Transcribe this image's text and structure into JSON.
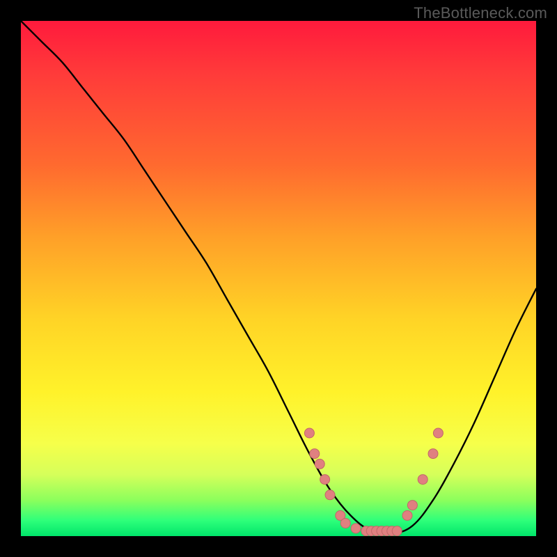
{
  "watermark": "TheBottleneck.com",
  "colors": {
    "curve": "#000000",
    "marker_fill": "#e08080",
    "marker_stroke": "#c06868",
    "gradient_top": "#ff1a3c",
    "gradient_bottom": "#00e56a"
  },
  "chart_data": {
    "type": "line",
    "title": "",
    "xlabel": "",
    "ylabel": "",
    "xlim": [
      0,
      100
    ],
    "ylim": [
      0,
      100
    ],
    "series": [
      {
        "name": "bottleneck-curve",
        "x": [
          0,
          4,
          8,
          12,
          16,
          20,
          24,
          28,
          32,
          36,
          40,
          44,
          48,
          52,
          56,
          60,
          64,
          68,
          72,
          76,
          80,
          84,
          88,
          92,
          96,
          100
        ],
        "y": [
          100,
          96,
          92,
          87,
          82,
          77,
          71,
          65,
          59,
          53,
          46,
          39,
          32,
          24,
          16,
          9,
          4,
          1,
          0.5,
          2,
          7,
          14,
          22,
          31,
          40,
          48
        ]
      }
    ],
    "markers": [
      {
        "x": 56,
        "y": 20
      },
      {
        "x": 57,
        "y": 16
      },
      {
        "x": 58,
        "y": 14
      },
      {
        "x": 59,
        "y": 11
      },
      {
        "x": 60,
        "y": 8
      },
      {
        "x": 62,
        "y": 4
      },
      {
        "x": 63,
        "y": 2.5
      },
      {
        "x": 65,
        "y": 1.5
      },
      {
        "x": 67,
        "y": 1
      },
      {
        "x": 68,
        "y": 1
      },
      {
        "x": 69,
        "y": 1
      },
      {
        "x": 70,
        "y": 1
      },
      {
        "x": 71,
        "y": 1
      },
      {
        "x": 72,
        "y": 1
      },
      {
        "x": 73,
        "y": 1
      },
      {
        "x": 75,
        "y": 4
      },
      {
        "x": 76,
        "y": 6
      },
      {
        "x": 78,
        "y": 11
      },
      {
        "x": 80,
        "y": 16
      },
      {
        "x": 81,
        "y": 20
      }
    ]
  }
}
